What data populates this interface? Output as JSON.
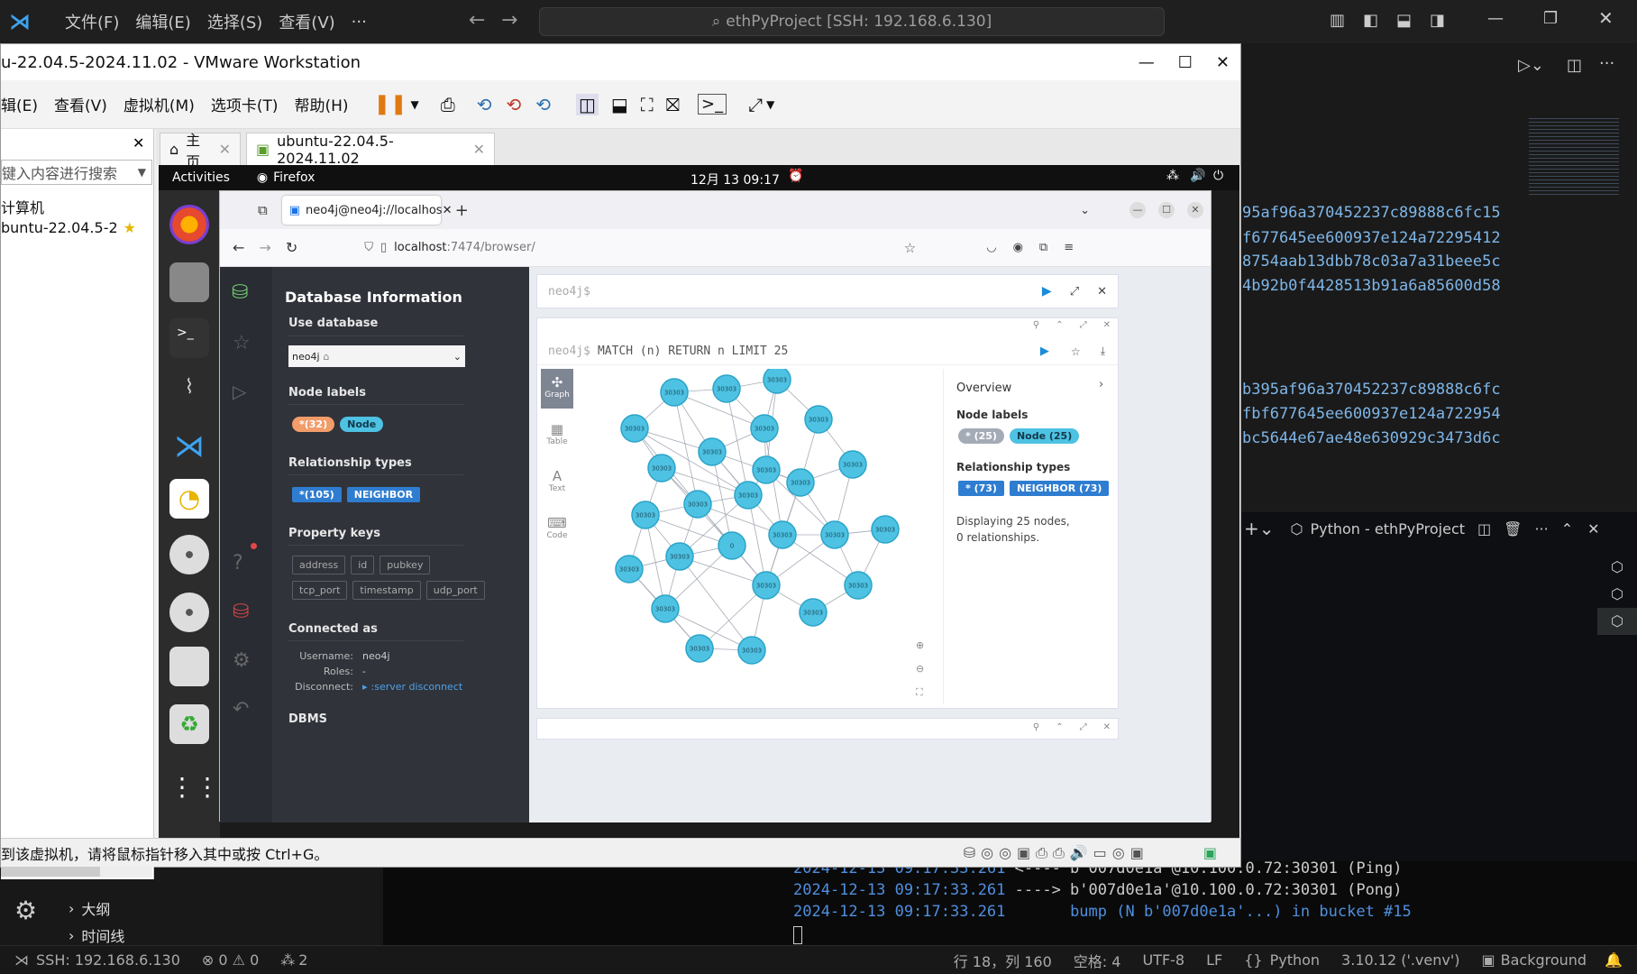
{
  "vscode": {
    "menu": [
      "文件(F)",
      "编辑(E)",
      "选择(S)",
      "查看(V)",
      "···"
    ],
    "search": "ethPyProject [SSH: 192.168.6.130]",
    "hashes": [
      "95af96a370452237c89888c6fc15",
      "f677645ee600937e124a72295412",
      "8754aab13dbb78c03a7a31beee5c",
      "4b92b0f4428513b91a6a85600d58",
      "b395af96a370452237c89888c6fc",
      "fbf677645ee600937e124a722954",
      "bc5644e67ae48e630929c3473d6c"
    ],
    "terminal_title": "Python - ethPyProject",
    "outline": [
      "大纲",
      "时间线"
    ],
    "terminal": [
      {
        "ts": "2024-12-13 09:17:33.261",
        "rest": " <---- b'007d0e1a'@10.100.0.72:30301 (Ping)"
      },
      {
        "ts": "2024-12-13 09:17:33.261",
        "rest": " ----> b'007d0e1a'@10.100.0.72:30301 (Pong)"
      },
      {
        "ts": "2024-12-13 09:17:33.261",
        "rest": "       ",
        "bump": "bump (N b'007d0e1a'...) in bucket #15"
      }
    ],
    "status": {
      "ssh": "SSH: 192.168.6.130",
      "problems": "⊗ 0 ⚠ 0",
      "ports": "2",
      "position": "行 18，列 160",
      "spaces": "空格: 4",
      "encoding": "UTF-8",
      "eol": "LF",
      "lang": "Python",
      "interpreter": "3.10.12 ('.venv')",
      "background": "Background"
    }
  },
  "vmware": {
    "title": "u-22.04.5-2024.11.02 - VMware Workstation",
    "menu": [
      "辑(E)",
      "查看(V)",
      "虚拟机(M)",
      "选项卡(T)",
      "帮助(H)"
    ],
    "lib_search": "键入内容进行搜索",
    "lib_items": [
      "计算机",
      "buntu-22.04.5-2"
    ],
    "tabs": [
      "主页",
      "ubuntu-22.04.5-2024.11.02"
    ],
    "status": "到该虚拟机，请将鼠标指针移入其中或按 Ctrl+G。"
  },
  "ubuntu": {
    "activities": "Activities",
    "app": "Firefox",
    "clock": "12月 13  09:17"
  },
  "firefox": {
    "tab": "neo4j@neo4j://localhos",
    "url_host": "localhost",
    "url_rest": ":7474/browser/"
  },
  "neo4j": {
    "title": "Database Information",
    "use_db": "Use database",
    "db": "neo4j",
    "node_labels_h": "Node labels",
    "node_labels": [
      "*(32)",
      "Node"
    ],
    "rel_types_h": "Relationship types",
    "rel_types": [
      "*(105)",
      "NEIGHBOR"
    ],
    "prop_keys_h": "Property keys",
    "prop_keys": [
      "address",
      "id",
      "pubkey",
      "tcp_port",
      "timestamp",
      "udp_port"
    ],
    "connected_h": "Connected as",
    "username_l": "Username:",
    "username": "neo4j",
    "roles_l": "Roles:",
    "roles": "-",
    "disconnect_l": "Disconnect:",
    "disconnect": ":server disconnect",
    "dbms": "DBMS",
    "editor_prompt": "neo4j$",
    "query_prompt": "neo4j$",
    "query": "MATCH (n) RETURN n LIMIT 25",
    "views": [
      "Graph",
      "Table",
      "Text",
      "Code"
    ],
    "overview": {
      "title": "Overview",
      "node_labels_h": "Node labels",
      "node_labels": [
        "* (25)",
        "Node (25)"
      ],
      "rel_types_h": "Relationship types",
      "rel_types": [
        "* (73)",
        "NEIGHBOR (73)"
      ],
      "summary": "Displaying 25 nodes, 0 relationships."
    },
    "node_label": "30303",
    "odd_label": "0"
  }
}
